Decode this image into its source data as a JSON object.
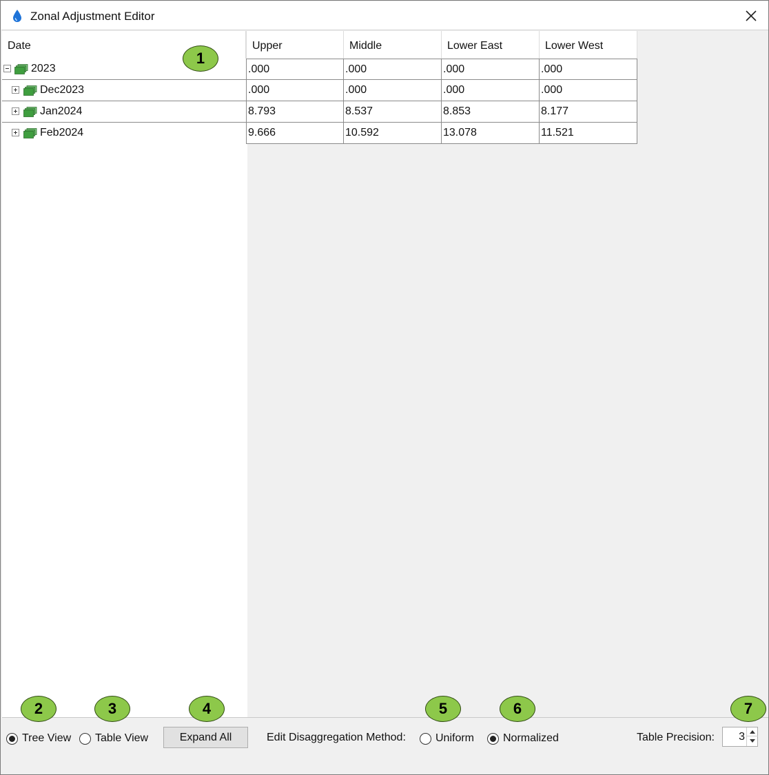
{
  "window": {
    "title": "Zonal Adjustment Editor"
  },
  "grid": {
    "columns": [
      "Date",
      "Upper",
      "Middle",
      "Lower East",
      "Lower West"
    ],
    "rows": [
      {
        "label": "2023",
        "expanded": true,
        "values": [
          ".000",
          ".000",
          ".000",
          ".000"
        ]
      },
      {
        "label": "Dec2023",
        "expanded": false,
        "values": [
          ".000",
          ".000",
          ".000",
          ".000"
        ]
      },
      {
        "label": "Jan2024",
        "expanded": false,
        "values": [
          "8.793",
          "8.537",
          "8.853",
          "8.177"
        ]
      },
      {
        "label": "Feb2024",
        "expanded": false,
        "values": [
          "9.666",
          "10.592",
          "13.078",
          "11.521"
        ]
      }
    ]
  },
  "view_mode": {
    "tree_label": "Tree View",
    "table_label": "Table View",
    "selected": "Tree View"
  },
  "expand_all_label": "Expand All",
  "disaggregation": {
    "label": "Edit Disaggregation Method:",
    "uniform_label": "Uniform",
    "normalized_label": "Normalized",
    "selected": "Normalized"
  },
  "precision": {
    "label": "Table Precision:",
    "value": "3"
  },
  "callouts": [
    "1",
    "2",
    "3",
    "4",
    "5",
    "6",
    "7"
  ],
  "colors": {
    "callout_fill": "#8dc84a",
    "folder_green": "#3f9e3f",
    "window_bg": "#f0f0f0"
  },
  "icons": [
    "water-drop-icon",
    "close-icon",
    "expand-icon",
    "collapse-icon",
    "folder-stack-icon"
  ]
}
